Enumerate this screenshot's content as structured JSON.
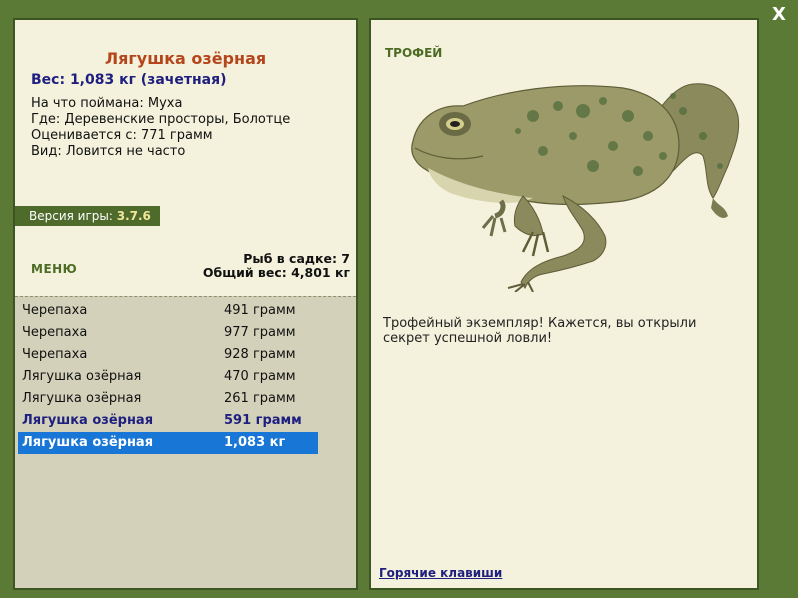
{
  "window": {
    "close_label": "X"
  },
  "fish": {
    "name": "Лягушка озёрная",
    "weight_line": "Вес: 1,083 кг (зачетная)",
    "bait_line": "На что поймана: Муха",
    "location_line": "Где: Деревенские просторы, Болотце",
    "rated_line": "Оценивается с: 771 грамм",
    "kind_line": "Вид: Ловится не часто"
  },
  "version": {
    "label": "Версия игры:",
    "value": "3.7.6"
  },
  "menu": {
    "label": "МЕНЮ"
  },
  "stats": {
    "fish_in_keepnet": "Рыб в садке: 7",
    "total_weight": "Общий вес: 4,801 кг"
  },
  "catch_list": [
    {
      "name": "Черепаха",
      "weight": "491 грамм",
      "style": "normal"
    },
    {
      "name": "Черепаха",
      "weight": "977 грамм",
      "style": "normal"
    },
    {
      "name": "Черепаха",
      "weight": "928 грамм",
      "style": "normal"
    },
    {
      "name": "Лягушка озёрная",
      "weight": "470 грамм",
      "style": "normal"
    },
    {
      "name": "Лягушка озёрная",
      "weight": "261 грамм",
      "style": "normal"
    },
    {
      "name": "Лягушка озёрная",
      "weight": "591 грамм",
      "style": "bold"
    },
    {
      "name": "Лягушка озёрная",
      "weight": "1,083 кг",
      "style": "selected"
    }
  ],
  "trophy": {
    "label": "ТРОФЕЙ",
    "description": "Трофейный экземпляр! Кажется, вы открыли секрет успешной ловли!",
    "image": "frog-image"
  },
  "hotkeys": {
    "label": "Горячие клавиши"
  },
  "colors": {
    "background": "#5b7a36",
    "panel": "#f4f2dc",
    "selected": "#1877d6",
    "title": "#b5461c",
    "accent_text": "#1f1f80"
  }
}
